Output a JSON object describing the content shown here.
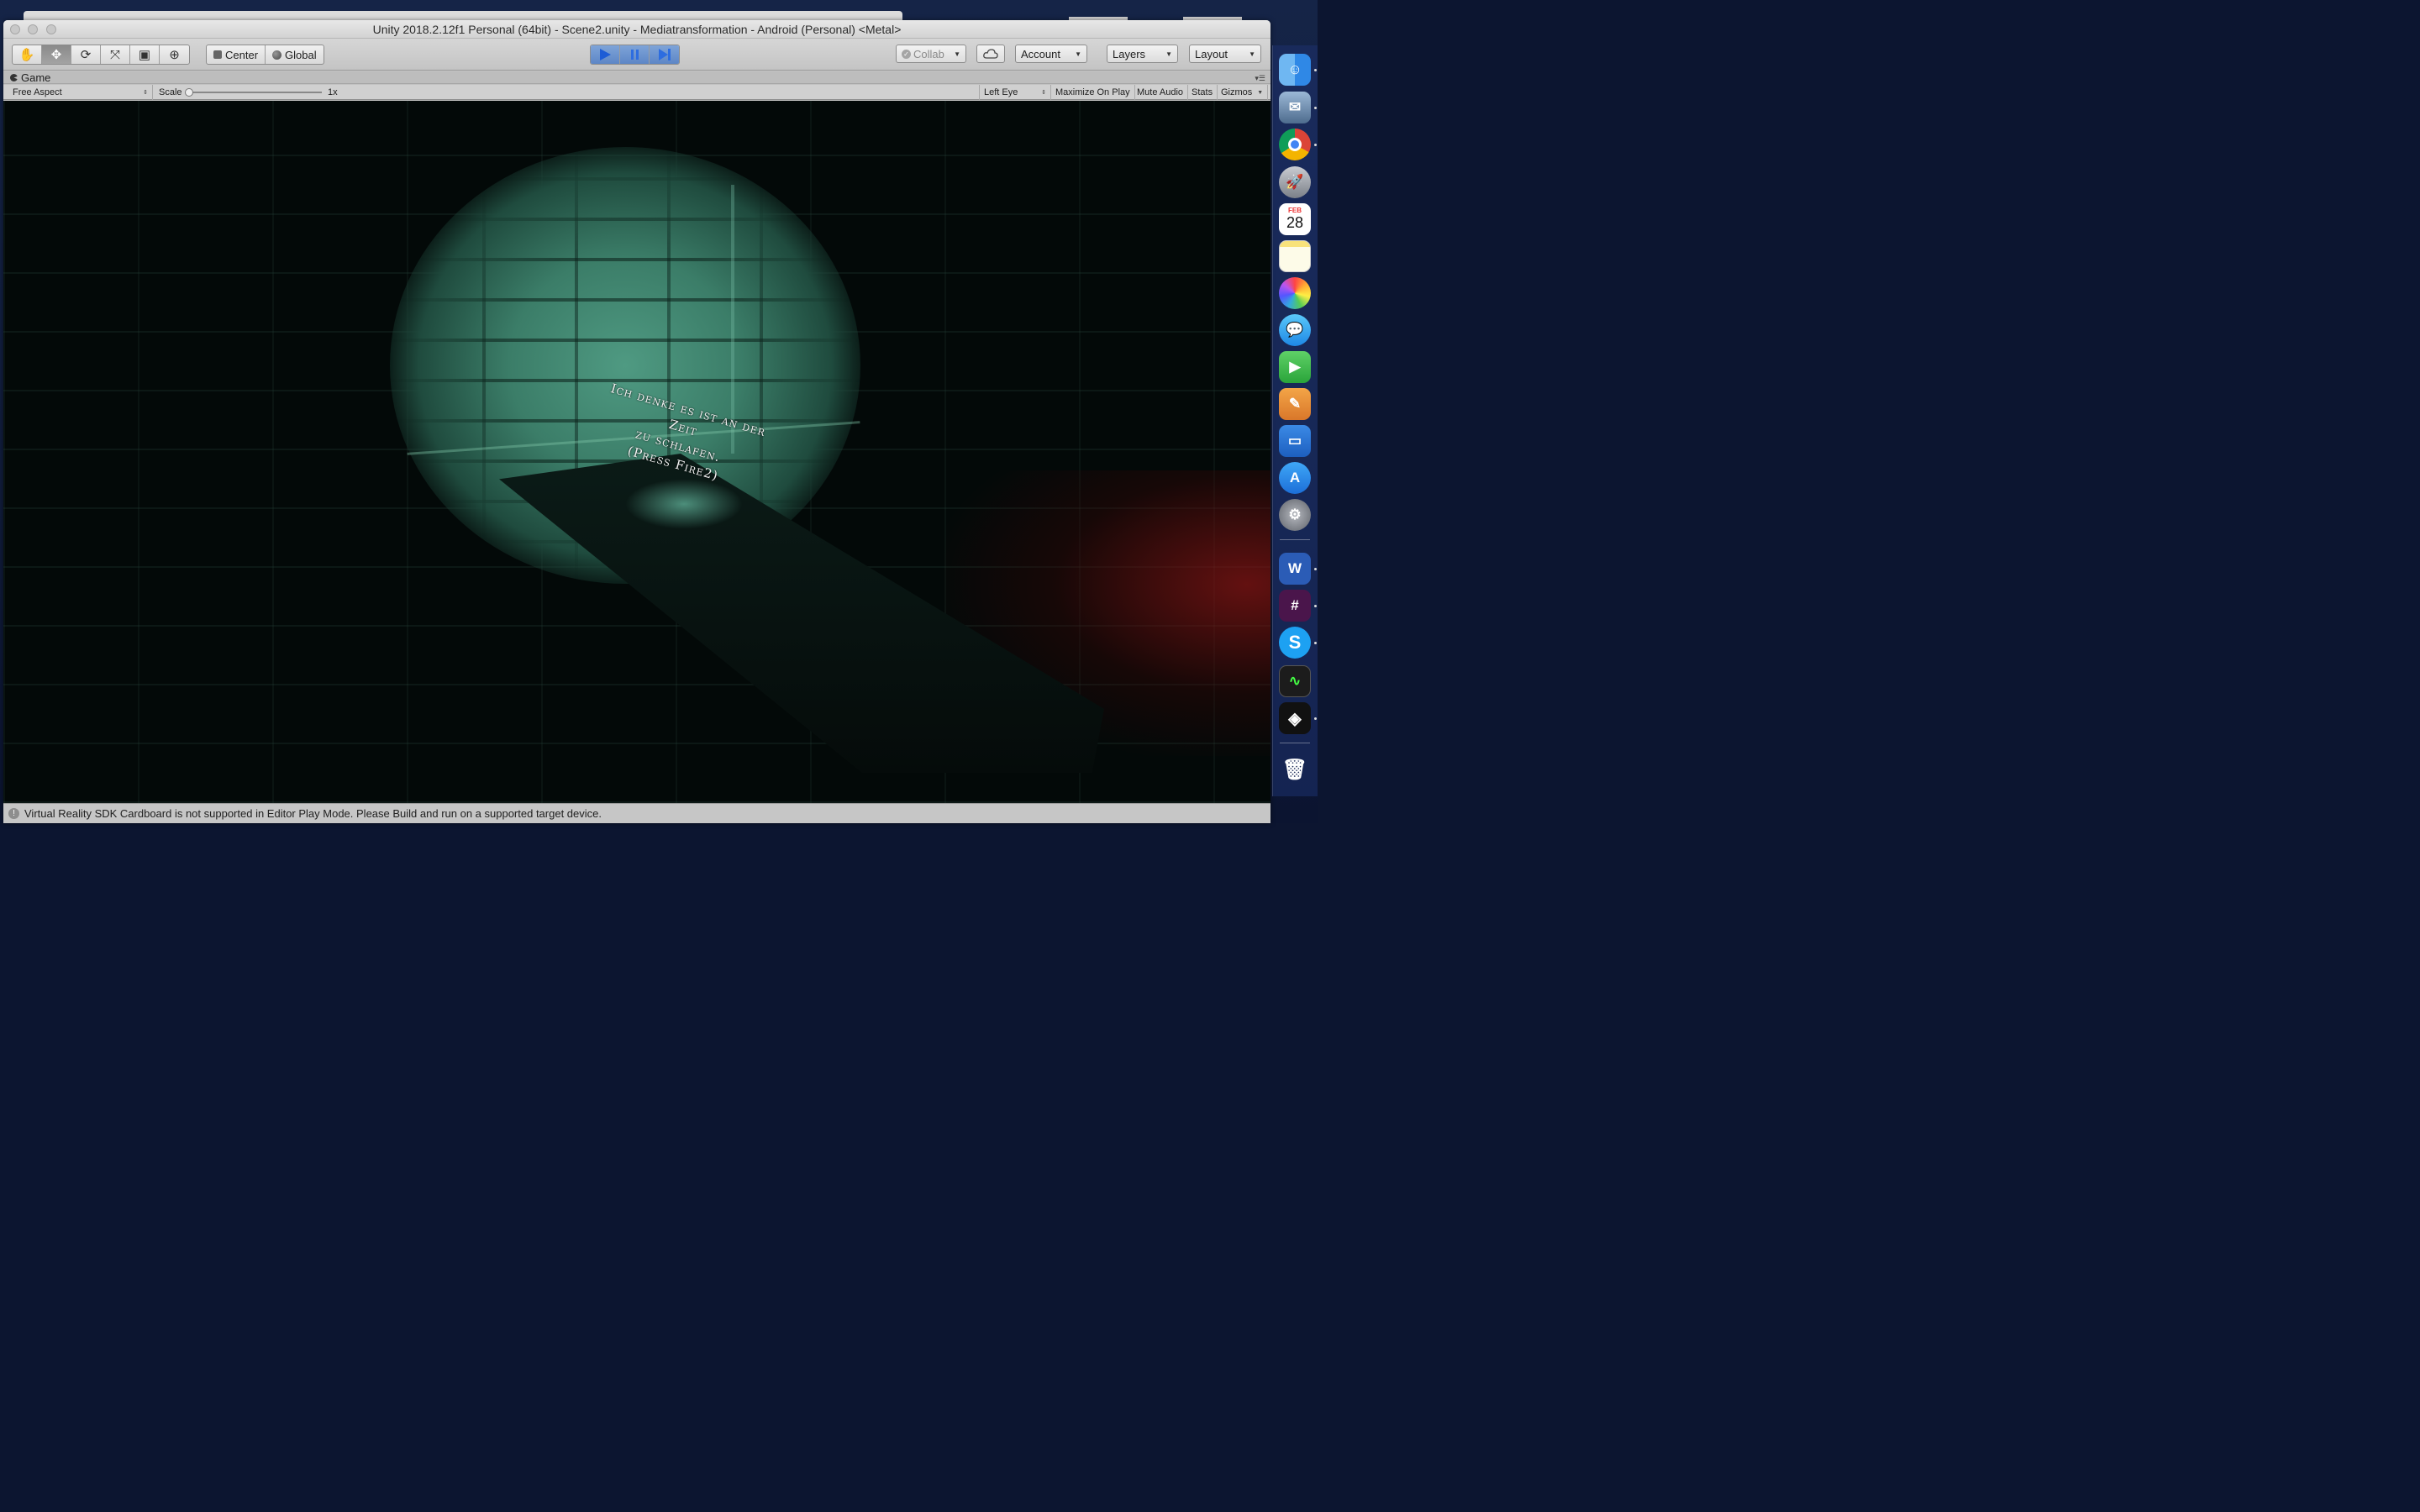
{
  "window": {
    "title": "Unity 2018.2.12f1 Personal (64bit) - Scene2.unity - Mediatransformation - Android (Personal) <Metal>"
  },
  "toolbar": {
    "tools": [
      "hand-tool",
      "move-tool",
      "rotate-tool",
      "scale-tool",
      "rect-tool",
      "transform-tool"
    ],
    "pivot_center_label": "Center",
    "pivot_global_label": "Global",
    "collab_label": "Collab",
    "account_label": "Account",
    "layers_label": "Layers",
    "layout_label": "Layout"
  },
  "game_tab": {
    "label": "Game"
  },
  "game_bar": {
    "aspect": "Free Aspect",
    "scale_label": "Scale",
    "scale_value": "1x",
    "scale_fraction": 0.0,
    "eye": "Left Eye",
    "maximize_label": "Maximize On Play",
    "mute_label": "Mute Audio",
    "stats_label": "Stats",
    "gizmos_label": "Gizmos"
  },
  "scene": {
    "line1": "Ich denke es ist an der Zeit",
    "line2": "zu schlafen.",
    "line3": "(Press Fire2)"
  },
  "status": {
    "message": "Virtual Reality SDK Cardboard is not supported in Editor Play Mode. Please Build and run on a supported target device."
  },
  "dock": {
    "calendar_month": "FEB",
    "calendar_day": "28",
    "apps": [
      "finder-icon",
      "preview-icon",
      "chrome-icon",
      "launchpad-icon",
      "calendar-icon",
      "notes-icon",
      "photos-icon",
      "messages-icon",
      "facetime-icon",
      "pages-icon",
      "keynote-icon",
      "app-store-icon",
      "system-preferences-icon",
      "word-icon",
      "slack-icon",
      "skype-icon",
      "activity-monitor-icon",
      "unity-icon",
      "trash-icon"
    ]
  }
}
